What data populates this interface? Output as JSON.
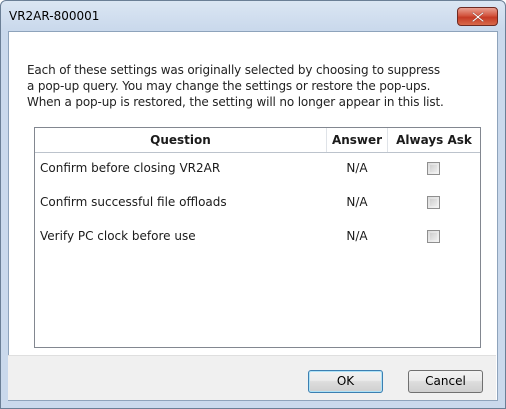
{
  "window": {
    "title": "VR2AR-800001"
  },
  "description": {
    "lines": [
      "Each of these settings was originally selected by choosing to suppress",
      "a pop-up query. You may change the settings or restore the pop-ups.",
      "When a pop-up is restored, the setting will no longer appear in this list."
    ]
  },
  "table": {
    "headers": {
      "question": "Question",
      "answer": "Answer",
      "always_ask": "Always Ask"
    },
    "rows": [
      {
        "question": "Confirm before closing VR2AR",
        "answer": "N/A",
        "always_ask": false
      },
      {
        "question": "Confirm successful file offloads",
        "answer": "N/A",
        "always_ask": false
      },
      {
        "question": "Verify PC clock before use",
        "answer": "N/A",
        "always_ask": false
      }
    ]
  },
  "buttons": {
    "ok": "OK",
    "cancel": "Cancel"
  },
  "icons": {
    "close": "close-icon"
  },
  "colors": {
    "title_bar": "#cad9ec",
    "close_button": "#c53a25",
    "footer": "#f0f0f0"
  }
}
